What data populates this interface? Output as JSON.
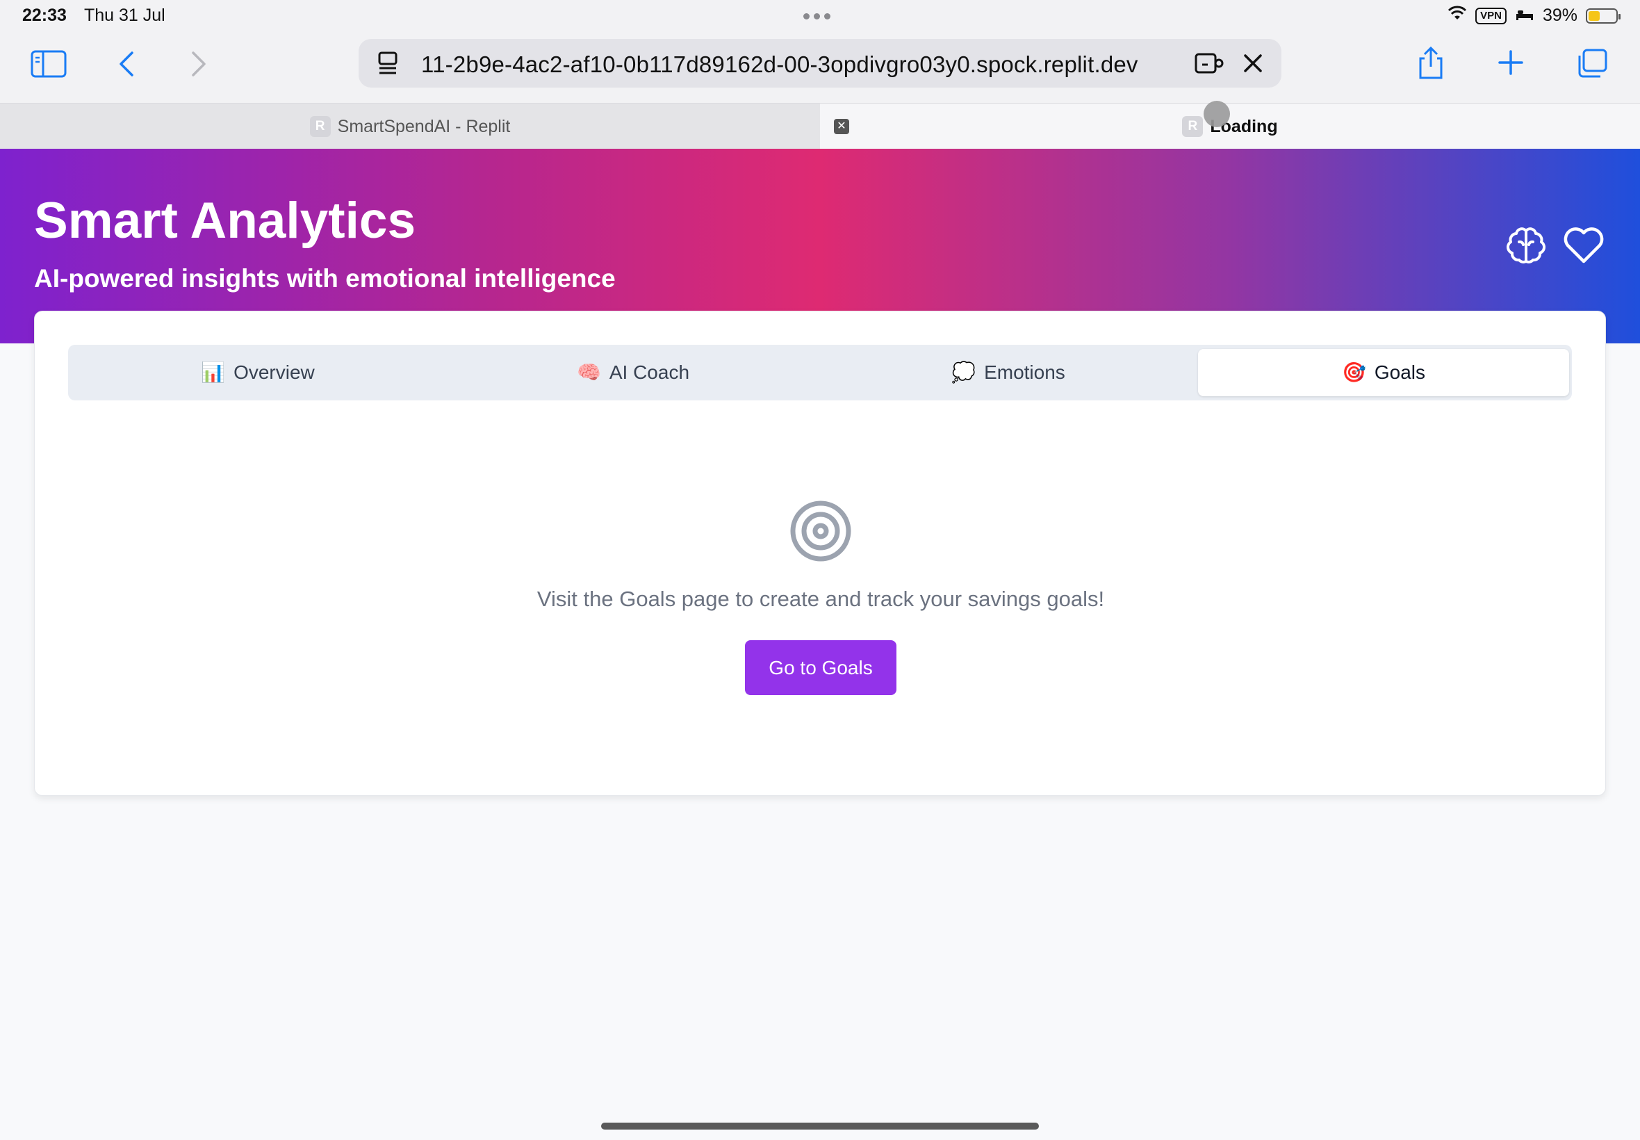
{
  "status_bar": {
    "time": "22:33",
    "date": "Thu 31 Jul",
    "vpn": "VPN",
    "battery": "39%"
  },
  "browser": {
    "url": "11-2b9e-4ac2-af10-0b117d89162d-00-3opdivgro03y0.spock.replit.dev",
    "tabs": [
      {
        "favicon": "R",
        "title": "SmartSpendAI - Replit"
      },
      {
        "favicon": "R",
        "title": "Loading"
      }
    ]
  },
  "header": {
    "title": "Smart Analytics",
    "subtitle": "AI-powered insights with emotional intelligence"
  },
  "tabs": [
    {
      "emoji": "📊",
      "label": "Overview"
    },
    {
      "emoji": "🧠",
      "label": "AI Coach"
    },
    {
      "emoji": "💭",
      "label": "Emotions"
    },
    {
      "emoji": "🎯",
      "label": "Goals"
    }
  ],
  "active_tab": "Goals",
  "goals_panel": {
    "message": "Visit the Goals page to create and track your savings goals!",
    "button_label": "Go to Goals"
  },
  "colors": {
    "accent": "#9333ea",
    "gradient": [
      "#7e22ce",
      "#de2a72",
      "#1f4fdc"
    ],
    "browser_accent": "#1a7cf5"
  }
}
